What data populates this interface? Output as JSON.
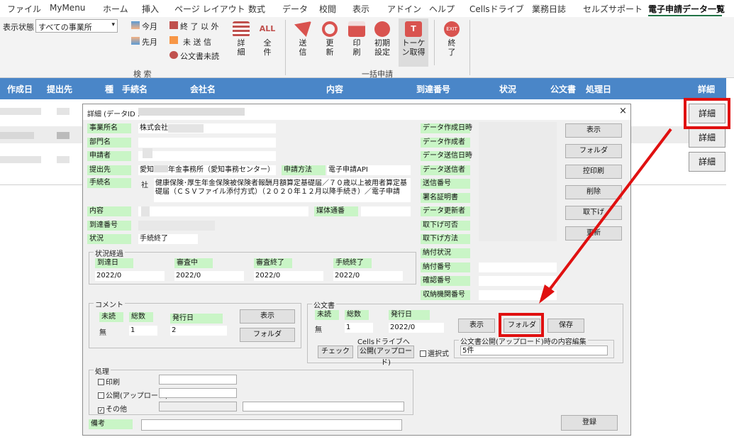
{
  "menu": [
    "ファイル",
    "MyMenu",
    "ホーム",
    "挿入",
    "ページ レイアウト",
    "数式",
    "データ",
    "校閲",
    "表示",
    "アドイン",
    "ヘルプ",
    "Cellsドライブ",
    "業務日誌",
    "セルズサポート",
    "電子申請データ一覧"
  ],
  "ribbon": {
    "status_label": "表示状態",
    "status_value": "すべての事業所",
    "this_month": "今月",
    "last_month": "先月",
    "except_end": "終 了 以 外",
    "unsent": "未 送 信",
    "unread_docs": "公文書未読",
    "detail": "詳細",
    "all": "全件",
    "search_group": "検 索",
    "send": "送信",
    "update": "更新",
    "print": "印刷",
    "init_settings": "初期設定",
    "token": "トーケン取得",
    "exit": "終了",
    "bulk_group": "一括申請",
    "colors": {
      "accent": "#217346",
      "header": "#4a86c8",
      "highlight": "#e01010"
    }
  },
  "grid": {
    "headers": [
      "作成日",
      "提出先",
      "種",
      "手続名",
      "会社名",
      "内容",
      "到達番号",
      "状況",
      "公文書",
      "処理日",
      "詳細"
    ],
    "row_button": "詳細"
  },
  "dialog": {
    "title": "詳細 (データID :",
    "close": "×",
    "fields": {
      "office_label": "事業所名",
      "office_value": "株式会社",
      "dept_label": "部門名",
      "applicant_label": "申請者",
      "submit_label": "提出先",
      "submit_value_prefix": "愛知",
      "submit_value_suffix": "年金事務所（愛知事務センター）",
      "method_label": "申請方法",
      "method_value": "電子申請API",
      "proc_label": "手続名",
      "proc_prefix": "社",
      "proc_value": "健康保険･厚生年金保険被保険者報酬月額算定基礎届／７０歳以上被用者算定基礎届（ＣＳＶファイル添付方式）（２０２０年１２月以降手続き）／電子申請",
      "content_label": "内容",
      "media_label": "媒体通番",
      "arrival_label": "到達番号",
      "status_label": "状況",
      "status_value": "手続終了"
    },
    "right_fields": [
      "データ作成日時",
      "データ作成者",
      "データ送信日時",
      "データ送信者",
      "送信番号",
      "署名証明書",
      "データ更新者",
      "取下げ可否",
      "取下げ方法",
      "納付状況",
      "納付番号",
      "確認番号",
      "収納機関番号"
    ],
    "side_buttons": [
      "表示",
      "フォルダ",
      "控印刷",
      "削除",
      "取下げ",
      "更新"
    ],
    "progress": {
      "title": "状況経過",
      "cols": [
        "到達日",
        "審査中",
        "審査終了",
        "手続終了"
      ],
      "values": [
        "2022/0",
        "2022/0",
        "2022/0",
        "2022/0"
      ]
    },
    "comment": {
      "title": "コメント",
      "unread": "未読",
      "total": "総数",
      "issued": "発行日",
      "unread_val": "無",
      "total_val": "1",
      "issued_val": "2",
      "show_btn": "表示",
      "folder_btn": "フォルダ"
    },
    "official": {
      "title": "公文書",
      "unread": "未読",
      "total": "総数",
      "issued": "発行日",
      "unread_val": "無",
      "total_val": "1",
      "issued_val": "2022/0",
      "show_btn": "表示",
      "folder_btn": "フォルダ",
      "save_btn": "保存",
      "cells_label": "Cellsドライブへ",
      "check_btn": "チェック",
      "publish_btn": "公開(アップロード)",
      "select_label": "選択式",
      "edit_title": "公文書公開(アップロード)時の内容編集",
      "edit_value": "5件"
    },
    "process": {
      "title": "処理",
      "print": "印刷",
      "publish": "公開(アップロード)",
      "other": "その他"
    },
    "note_label": "備考",
    "register_btn": "登録"
  }
}
